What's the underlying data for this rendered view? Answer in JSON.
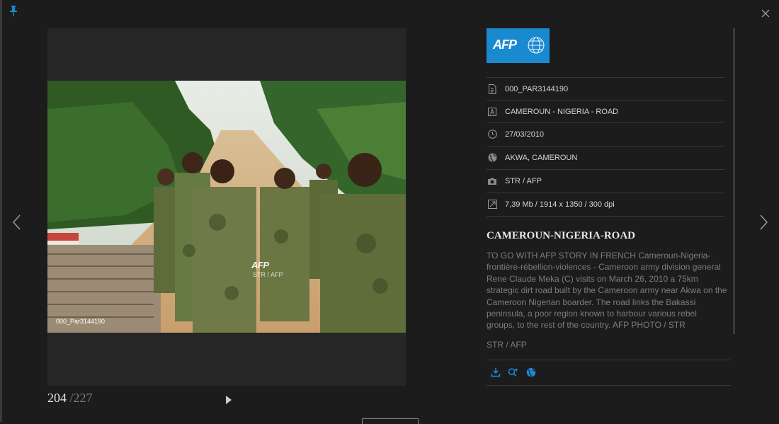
{
  "photo": {
    "watermark_logo": "AFP",
    "watermark_credit": "STR / AFP",
    "id_label": "000_Par3144190"
  },
  "counter": {
    "current": "204",
    "total": "/227"
  },
  "agency": {
    "logo_text": "AFP"
  },
  "metadata": [
    {
      "icon": "file-icon",
      "text": "000_PAR3144190"
    },
    {
      "icon": "title-icon",
      "text": "CAMEROUN - NIGERIA - ROAD"
    },
    {
      "icon": "clock-icon",
      "text": "27/03/2010"
    },
    {
      "icon": "globe-icon",
      "text": "AKWA, CAMEROUN"
    },
    {
      "icon": "camera-icon",
      "text": "STR / AFP"
    },
    {
      "icon": "resize-icon",
      "text": "7,39 Mb / 1914 x 1350 / 300 dpi"
    }
  ],
  "headline": "CAMEROUN-NIGERIA-ROAD",
  "caption": "TO GO WITH AFP STORY IN FRENCH Cameroun-Nigeria-frontière-rébellion-violences - Cameroon army division general Rene Claude Meka (C) visits on March 26, 2010 a 75km strategic dirt road built by the Cameroon army near Akwa on the Cameroon Nigerian boarder. The road links the Bakassi peninsula, a poor region known to harbour various rebel groups, to the rest of the country. AFP PHOTO / STR",
  "caption_credit": "STR / AFP",
  "actions": [
    "download-icon",
    "search-similar-icon",
    "globe-icon"
  ],
  "colors": {
    "accent": "#1a8ad0",
    "background": "#1c1c1c"
  }
}
